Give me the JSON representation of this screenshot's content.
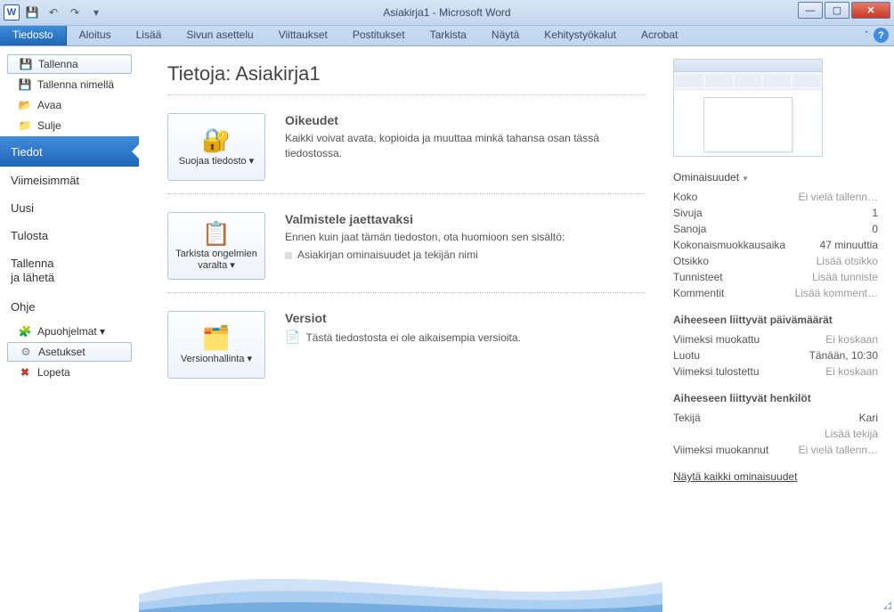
{
  "window": {
    "app_icon_letter": "W",
    "title": "Asiakirja1  -  Microsoft Word"
  },
  "qat": {
    "save_tip": "save-icon",
    "undo_tip": "undo-icon",
    "redo_tip": "redo-icon"
  },
  "ribbon": {
    "file": "Tiedosto",
    "tabs": [
      "Aloitus",
      "Lisää",
      "Sivun asettelu",
      "Viittaukset",
      "Postitukset",
      "Tarkista",
      "Näytä",
      "Kehitystyökalut",
      "Acrobat"
    ]
  },
  "left": {
    "save": "Tallenna",
    "save_as": "Tallenna nimellä",
    "open": "Avaa",
    "close": "Sulje",
    "info": "Tiedot",
    "recent": "Viimeisimmät",
    "new": "Uusi",
    "print": "Tulosta",
    "save_send_a": "Tallenna",
    "save_send_b": "ja lähetä",
    "help": "Ohje",
    "addins": "Apuohjelmat ▾",
    "options": "Asetukset",
    "exit": "Lopeta"
  },
  "center": {
    "heading": "Tietoja: Asiakirja1",
    "sec1": {
      "btn_label": "Suojaa tiedosto ▾",
      "title": "Oikeudet",
      "desc": "Kaikki voivat avata, kopioida ja muuttaa minkä tahansa osan tässä tiedostossa."
    },
    "sec2": {
      "btn_label": "Tarkista ongelmien varalta ▾",
      "title": "Valmistele jaettavaksi",
      "desc": "Ennen kuin jaat tämän tiedoston, ota huomioon sen sisältö:",
      "bullet1": "Asiakirjan ominaisuudet ja tekijän nimi"
    },
    "sec3": {
      "btn_label": "Versionhallinta ▾",
      "title": "Versiot",
      "desc": "Tästä tiedostosta ei ole aikaisempia versioita."
    }
  },
  "right": {
    "props_label": "Ominaisuudet",
    "rows": {
      "size_l": "Koko",
      "size_v": "Ei vielä tallenn…",
      "pages_l": "Sivuja",
      "pages_v": "1",
      "words_l": "Sanoja",
      "words_v": "0",
      "edit_l": "Kokonaismuokkausaika",
      "edit_v": "47 minuuttia",
      "title_l": "Otsikko",
      "title_v": "Lisää otsikko",
      "tags_l": "Tunnisteet",
      "tags_v": "Lisää tunniste",
      "comm_l": "Kommentit",
      "comm_v": "Lisää komment…"
    },
    "dates_head": "Aiheeseen liittyvät päivämäärät",
    "dates": {
      "mod_l": "Viimeksi muokattu",
      "mod_v": "Ei koskaan",
      "created_l": "Luotu",
      "created_v": "Tänään, 10:30",
      "printed_l": "Viimeksi tulostettu",
      "printed_v": "Ei koskaan"
    },
    "people_head": "Aiheeseen liittyvät henkilöt",
    "people": {
      "author_l": "Tekijä",
      "author_v": "Kari",
      "add_author": "Lisää tekijä",
      "lastmod_l": "Viimeksi muokannut",
      "lastmod_v": "Ei vielä tallenn…"
    },
    "show_all": "Näytä kaikki ominaisuudet"
  }
}
